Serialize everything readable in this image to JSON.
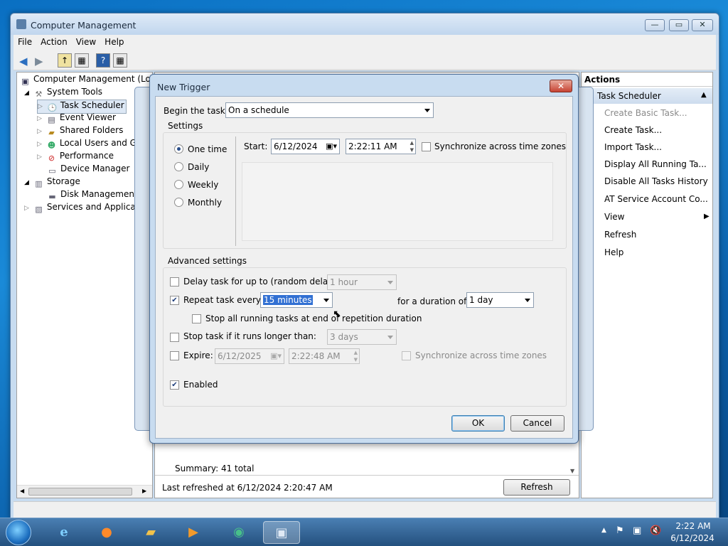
{
  "window": {
    "title": "Computer Management",
    "controls": {
      "minimize": "—",
      "maximize": "▭",
      "close": "✕"
    }
  },
  "menu": [
    "File",
    "Action",
    "View",
    "Help"
  ],
  "tree": {
    "items": [
      {
        "label": "Computer Management (Local",
        "level": 0
      },
      {
        "label": "System Tools",
        "level": 1
      },
      {
        "label": "Task Scheduler",
        "level": 2
      },
      {
        "label": "Event Viewer",
        "level": 2
      },
      {
        "label": "Shared Folders",
        "level": 2
      },
      {
        "label": "Local Users and Gro",
        "level": 2
      },
      {
        "label": "Performance",
        "level": 2
      },
      {
        "label": "Device Manager",
        "level": 2
      },
      {
        "label": "Storage",
        "level": 1
      },
      {
        "label": "Disk Management",
        "level": 2
      },
      {
        "label": "Services and Applicatio",
        "level": 1
      }
    ]
  },
  "middle": {
    "summary": "Summary: 41 total",
    "last_refreshed": "Last refreshed at 6/12/2024 2:20:47 AM",
    "refresh_button": "Refresh"
  },
  "actions": {
    "header": "Actions",
    "section": "Task Scheduler",
    "items": [
      {
        "label": "Create Basic Task...",
        "disabled": true
      },
      {
        "label": "Create Task...",
        "disabled": false
      },
      {
        "label": "Import Task...",
        "disabled": false
      },
      {
        "label": "Display All Running Ta...",
        "disabled": false
      },
      {
        "label": "Disable All Tasks History",
        "disabled": false
      },
      {
        "label": "AT Service Account Co...",
        "disabled": false
      },
      {
        "label": "View",
        "disabled": false
      },
      {
        "label": "Refresh",
        "disabled": false
      },
      {
        "label": "Help",
        "disabled": false
      }
    ]
  },
  "dialog": {
    "title": "New Trigger",
    "close_glyph": "✕",
    "begin_label": "Begin the task:",
    "begin_value": "On a schedule",
    "settings_label": "Settings",
    "schedule_options": [
      {
        "label": "One time",
        "selected": true
      },
      {
        "label": "Daily",
        "selected": false
      },
      {
        "label": "Weekly",
        "selected": false
      },
      {
        "label": "Monthly",
        "selected": false
      }
    ],
    "start_label": "Start:",
    "start_date": "6/12/2024",
    "start_time": "2:22:11 AM",
    "sync_label": "Synchronize across time zones",
    "advanced_label": "Advanced settings",
    "delay_label": "Delay task for up to (random delay):",
    "delay_value": "1 hour",
    "repeat_label": "Repeat task every:",
    "repeat_value": "15 minutes",
    "duration_label": "for a duration of:",
    "duration_value": "1 day",
    "stop_running_label": "Stop all running tasks at end of repetition duration",
    "stop_longer_label": "Stop task if it runs longer than:",
    "stop_longer_value": "3 days",
    "expire_label": "Expire:",
    "expire_date": "6/12/2025",
    "expire_time": "2:22:48 AM",
    "expire_sync_label": "Synchronize across time zones",
    "enabled_label": "Enabled",
    "ok": "OK",
    "cancel": "Cancel"
  },
  "taskbar": {
    "time": "2:22 AM",
    "date": "6/12/2024"
  }
}
